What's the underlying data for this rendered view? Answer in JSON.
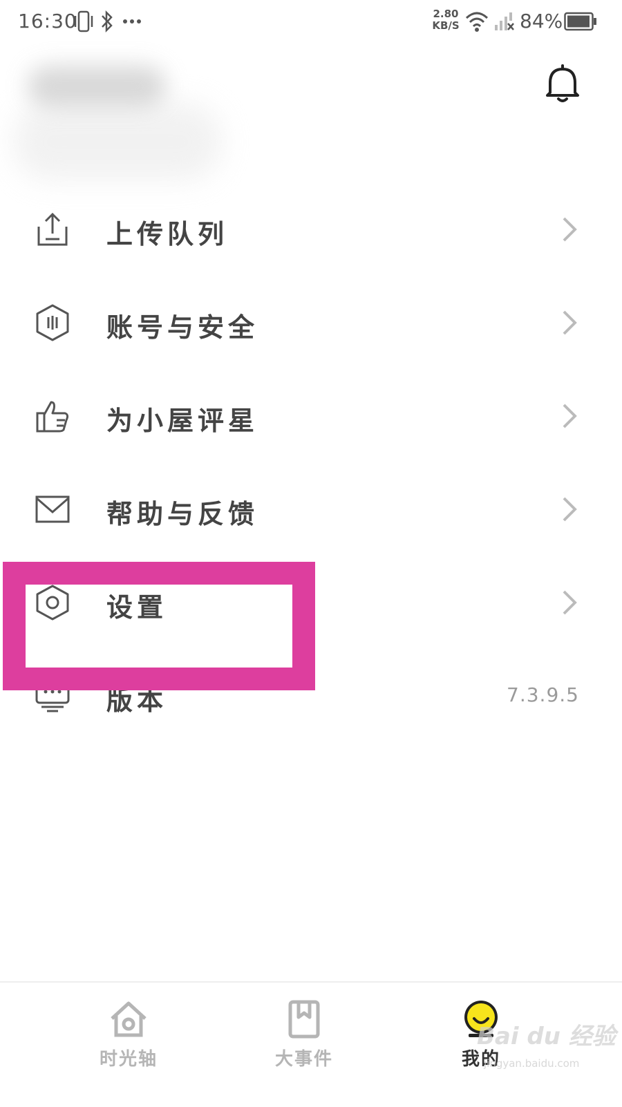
{
  "status_bar": {
    "time": "16:30",
    "net_speed_value": "2.80",
    "net_speed_unit": "KB/S",
    "battery": "84%",
    "icons": [
      "vibrate-icon",
      "bluetooth-icon",
      "more-icon",
      "wifi-icon",
      "signal-icon",
      "battery-icon"
    ]
  },
  "header": {
    "bell_icon": "bell-icon"
  },
  "menu": {
    "items": [
      {
        "label": "上传队列",
        "icon": "upload-icon"
      },
      {
        "label": "账号与安全",
        "icon": "shield-icon"
      },
      {
        "label": "为小屋评星",
        "icon": "thumbs-up-icon"
      },
      {
        "label": "帮助与反馈",
        "icon": "mail-icon"
      },
      {
        "label": "设置",
        "icon": "settings-hexagon-icon"
      },
      {
        "label": "版本",
        "icon": "monitor-chat-icon",
        "value": "7.3.9.5"
      }
    ]
  },
  "bottom_nav": {
    "items": [
      {
        "label": "时光轴",
        "icon": "home-icon",
        "active": false
      },
      {
        "label": "大事件",
        "icon": "bookmark-icon",
        "active": false
      },
      {
        "label": "我的",
        "icon": "smiley-avatar-icon",
        "active": true
      }
    ]
  },
  "watermark": {
    "text": "Bai du 经验",
    "sub": "jingyan.baidu.com"
  },
  "colors": {
    "highlight": "#dd3e9e",
    "avatar_yellow": "#f7e41c",
    "text": "#444444",
    "muted": "#9a9a9a"
  }
}
